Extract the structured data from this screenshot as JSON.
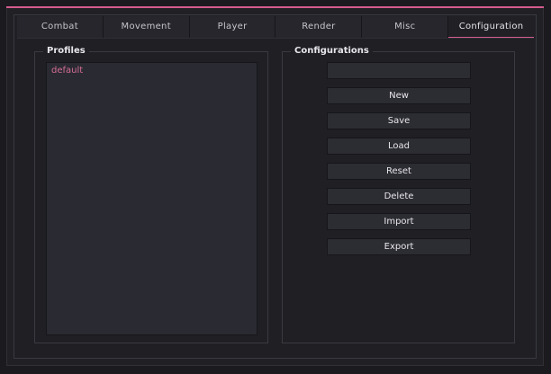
{
  "colors": {
    "accent": "#d45c8e",
    "background": "#1b1b1f",
    "panel": "#1f1f24",
    "list_bg": "#2a2a32",
    "button_bg": "#2c2c33",
    "text": "#e6e6ea"
  },
  "tabs": [
    {
      "label": "Combat",
      "active": false
    },
    {
      "label": "Movement",
      "active": false
    },
    {
      "label": "Player",
      "active": false
    },
    {
      "label": "Render",
      "active": false
    },
    {
      "label": "Misc",
      "active": false
    },
    {
      "label": "Configuration",
      "active": true
    }
  ],
  "profiles": {
    "title": "Profiles",
    "items": [
      "default"
    ],
    "selected": "default"
  },
  "configurations": {
    "title": "Configurations",
    "name_input": {
      "value": "",
      "placeholder": ""
    },
    "buttons": {
      "new": "New",
      "save": "Save",
      "load": "Load",
      "reset": "Reset",
      "delete": "Delete",
      "import": "Import",
      "export": "Export"
    }
  }
}
